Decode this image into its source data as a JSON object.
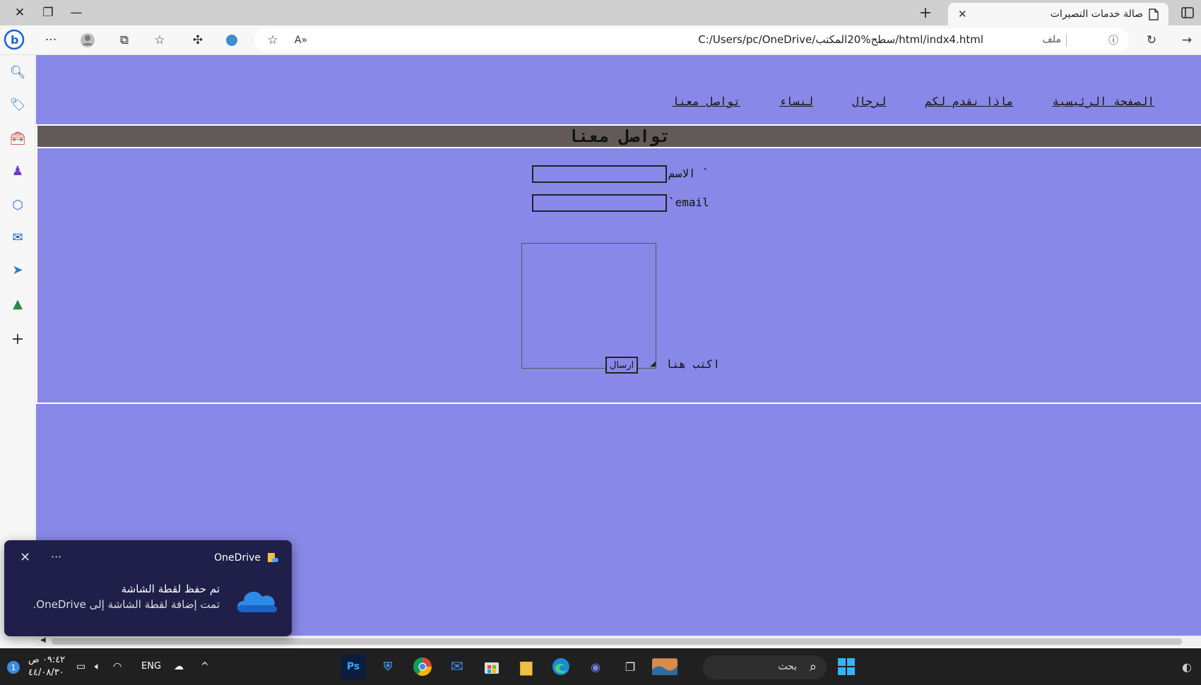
{
  "browser": {
    "tab_title": "صالة خدمات النصيرات",
    "tab_close": "✕",
    "new_tab": "+",
    "url": "C:/Users/pc/OneDrive/سطح%20المكتب/html/indx4.html",
    "file_label": "ملف"
  },
  "page": {
    "nav": [
      "الصفحة الرئيسية",
      "ماذا نقدم لكم",
      "لرجال",
      "لنساء",
      "تواصل معنا"
    ],
    "heading": "تواصل معنا",
    "form": {
      "name_label": "الاسم `",
      "email_label": "`email",
      "message_label": "اكتب هنا",
      "submit_label": "ارسال"
    }
  },
  "toast": {
    "app": "OneDrive",
    "title": "تم حفظ لقطة الشاشة",
    "body": "تمت إضافة لقطة الشاشة إلى OneDrive.",
    "more": "···",
    "close": "✕"
  },
  "taskbar": {
    "search_text": "بحث",
    "lang": "ENG",
    "time": "٠٩:٤٢ ص",
    "date": "٤٤/٠٨/٣٠",
    "notification_count": "1"
  },
  "colors": {
    "page_background": "#8888e8",
    "heading_bar": "#625a58",
    "taskbar": "#202020",
    "toast": "#1f1f4a"
  }
}
